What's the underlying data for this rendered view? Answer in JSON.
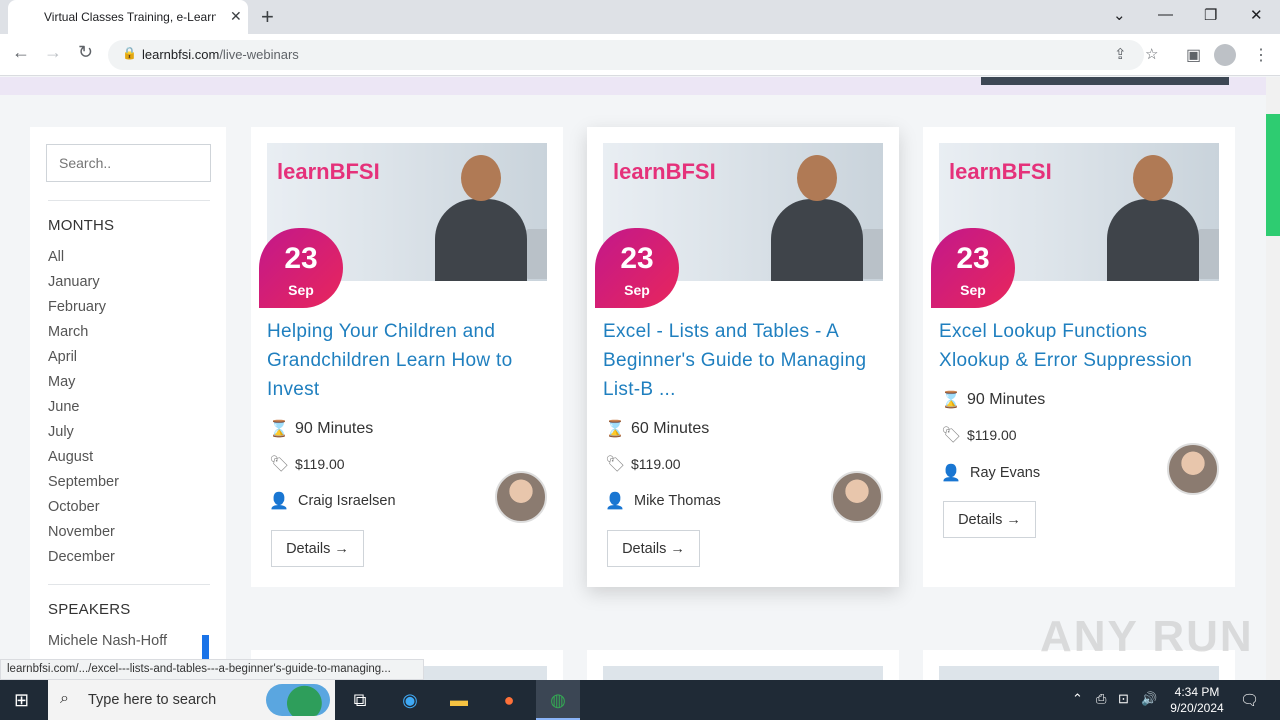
{
  "browser": {
    "tab_title": "Virtual Classes Training, e-Learni",
    "tab_close": "✕",
    "new_tab": "+",
    "url_host": "learnbfsi.com",
    "url_path": "/live-webinars",
    "status_url": "learnbfsi.com/.../excel---lists-and-tables---a-beginner's-guide-to-managing..."
  },
  "sidebar": {
    "search_placeholder": "Search..",
    "months_heading": "MONTHS",
    "months": [
      "All",
      "January",
      "February",
      "March",
      "April",
      "May",
      "June",
      "July",
      "August",
      "September",
      "October",
      "November",
      "December"
    ],
    "speakers_heading": "SPEAKERS",
    "speakers": [
      "Michele Nash-Hoff"
    ]
  },
  "cards": [
    {
      "logo": "learnBFSI",
      "day": "23",
      "month": "Sep",
      "title": "Helping Your Children and Grandchildren Learn How to Invest",
      "duration": "90 Minutes",
      "price": "$119.00",
      "speaker": "Craig Israelsen",
      "details": "Details"
    },
    {
      "logo": "learnBFSI",
      "day": "23",
      "month": "Sep",
      "title": "Excel - Lists and Tables - A Beginner's Guide to Managing List-B ...",
      "duration": "60 Minutes",
      "price": "$119.00",
      "speaker": "Mike Thomas",
      "details": "Details"
    },
    {
      "logo": "learnBFSI",
      "day": "23",
      "month": "Sep",
      "title": "Excel Lookup Functions Xlookup & Error Suppression",
      "duration": "90 Minutes",
      "price": "$119.00",
      "speaker": "Ray Evans",
      "details": "Details"
    }
  ],
  "watermark": "ANY RUN",
  "taskbar": {
    "search_text": "Type here to search",
    "time": "4:34 PM",
    "date": "9/20/2024"
  },
  "colors": {
    "accent_title": "#1f7fbf",
    "badge_from": "#c2188b",
    "badge_to": "#e8265c",
    "scroll_thumb": "#2ecc71"
  }
}
